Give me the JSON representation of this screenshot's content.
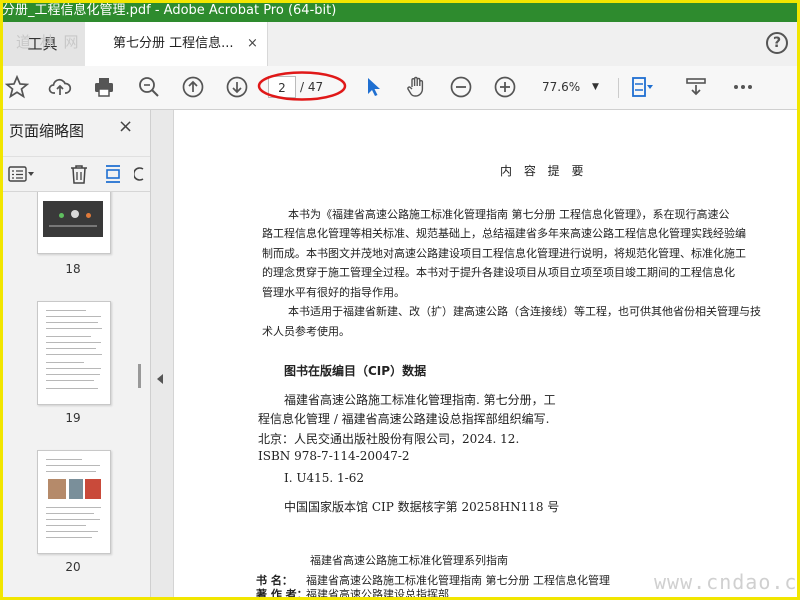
{
  "window": {
    "title": "分册_工程信息化管理.pdf - Adobe Acrobat Pro (64-bit)"
  },
  "tabs": {
    "tools_label": "工具",
    "doc_label": "第七分册 工程信息...",
    "close": "×",
    "watermark": "道 林 网",
    "help": "?"
  },
  "toolbar": {
    "page_current": "2",
    "page_total": "/ 47",
    "zoom": "77.6%",
    "icons": [
      "star-icon",
      "cloud-upload-icon",
      "print-icon",
      "zoom-search-icon",
      "page-up-icon",
      "page-down-icon",
      "select-cursor-icon",
      "hand-icon",
      "zoom-out-icon",
      "zoom-in-icon",
      "fit-page-icon",
      "scroll-mode-icon",
      "more-icon"
    ]
  },
  "sidebar": {
    "title": "页面缩略图",
    "close": "×",
    "thumbnails": [
      {
        "page": "18"
      },
      {
        "page": "19"
      },
      {
        "page": "20"
      }
    ]
  },
  "document": {
    "heading": "内 容 提 要",
    "summary": [
      "本书为《福建省高速公路施工标准化管理指南   第七分册   工程信息化管理》，系在现行高速公",
      "路工程信息化管理等相关标准、规范基础上，总结福建省多年来高速公路工程信息化管理实践经验编",
      "制而成。本书图文并茂地对高速公路建设项目工程信息化管理进行说明，将规范化管理、标准化施工",
      "的理念贯穿于施工管理全过程。本书对于提升各建设项目从项目立项至项目竣工期间的工程信息化",
      "管理水平有很好的指导作用。",
      "本书适用于福建省新建、改（扩）建高速公路（含连接线）等工程，也可供其他省份相关管理与技",
      "术人员参考使用。"
    ],
    "cip_title": "图书在版编目（CIP）数据",
    "cip_lines": [
      "福建省高速公路施工标准化管理指南. 第七分册，工",
      "程信息化管理 / 福建省高速公路建设总指挥部组织编写.",
      "北京：人民交通出版社股份有限公司，2024. 12.",
      "ISBN 978-7-114-20047-2",
      "Ⅰ. U415. 1-62",
      "中国国家版本馆 CIP 数据核字第 20258HN118 号"
    ],
    "series": "福建省高速公路施工标准化管理系列指南",
    "book_label": "书    名：",
    "book_name": "福建省高速公路施工标准化管理指南   第七分册   工程信息化管理",
    "author_label": "著 作 者：",
    "author_name": "福建省高速公路建设总指挥部",
    "watermark": "www.cndao.com"
  },
  "colors": {
    "title_bar": "#2e8b2e",
    "frame": "#f2e600",
    "annotation_ellipse": "#e01818",
    "accent_blue": "#1f6fd1"
  }
}
